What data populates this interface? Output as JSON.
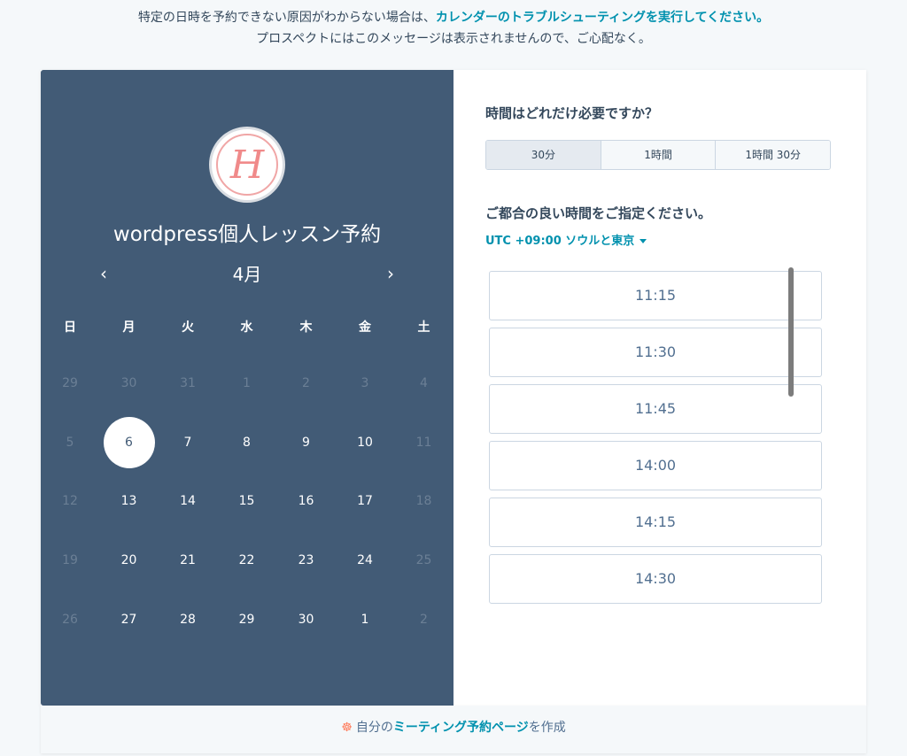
{
  "notice": {
    "line1_prefix": "特定の日時を予約できない原因がわからない場合は、",
    "line1_link": "カレンダーのトラブルシューティングを実行してください。",
    "line2": "プロスペクトにはこのメッセージは表示されませんので、ご心配なく。"
  },
  "profile": {
    "avatar_letter": "H",
    "title": "wordpress個人レッスン予約"
  },
  "calendar": {
    "month": "4月",
    "prev": "‹",
    "next": "›",
    "weekdays": [
      "日",
      "月",
      "火",
      "水",
      "木",
      "金",
      "土"
    ],
    "weeks": [
      [
        {
          "d": "29",
          "s": "muted"
        },
        {
          "d": "30",
          "s": "muted"
        },
        {
          "d": "31",
          "s": "muted"
        },
        {
          "d": "1",
          "s": "muted"
        },
        {
          "d": "2",
          "s": "muted"
        },
        {
          "d": "3",
          "s": "muted"
        },
        {
          "d": "4",
          "s": "muted"
        }
      ],
      [
        {
          "d": "5",
          "s": "muted"
        },
        {
          "d": "6",
          "s": "selected"
        },
        {
          "d": "7",
          "s": "avail"
        },
        {
          "d": "8",
          "s": "avail"
        },
        {
          "d": "9",
          "s": "avail"
        },
        {
          "d": "10",
          "s": "avail"
        },
        {
          "d": "11",
          "s": "muted"
        }
      ],
      [
        {
          "d": "12",
          "s": "muted"
        },
        {
          "d": "13",
          "s": "avail"
        },
        {
          "d": "14",
          "s": "avail"
        },
        {
          "d": "15",
          "s": "avail"
        },
        {
          "d": "16",
          "s": "avail"
        },
        {
          "d": "17",
          "s": "avail"
        },
        {
          "d": "18",
          "s": "muted"
        }
      ],
      [
        {
          "d": "19",
          "s": "muted"
        },
        {
          "d": "20",
          "s": "avail"
        },
        {
          "d": "21",
          "s": "avail"
        },
        {
          "d": "22",
          "s": "avail"
        },
        {
          "d": "23",
          "s": "avail"
        },
        {
          "d": "24",
          "s": "avail"
        },
        {
          "d": "25",
          "s": "muted"
        }
      ],
      [
        {
          "d": "26",
          "s": "muted"
        },
        {
          "d": "27",
          "s": "avail"
        },
        {
          "d": "28",
          "s": "avail"
        },
        {
          "d": "29",
          "s": "avail"
        },
        {
          "d": "30",
          "s": "avail"
        },
        {
          "d": "1",
          "s": "avail"
        },
        {
          "d": "2",
          "s": "muted"
        }
      ]
    ]
  },
  "booking": {
    "duration_question": "時間はどれだけ必要ですか？",
    "durations": [
      "30分",
      "1時間",
      "1時間 30分"
    ],
    "time_question": "ご都合の良い時間をご指定ください。",
    "timezone": "UTC +09:00 ソウルと東京",
    "slots": [
      "11:15",
      "11:30",
      "11:45",
      "14:00",
      "14:15",
      "14:30"
    ]
  },
  "footer": {
    "icon": "hubspot-sprocket-icon",
    "prefix": "自分の",
    "link": "ミーティング予約ページ",
    "suffix": "を作成"
  },
  "colors": {
    "sidebar": "#425b76",
    "link": "#0091ae",
    "accent": "#ff7a59"
  }
}
